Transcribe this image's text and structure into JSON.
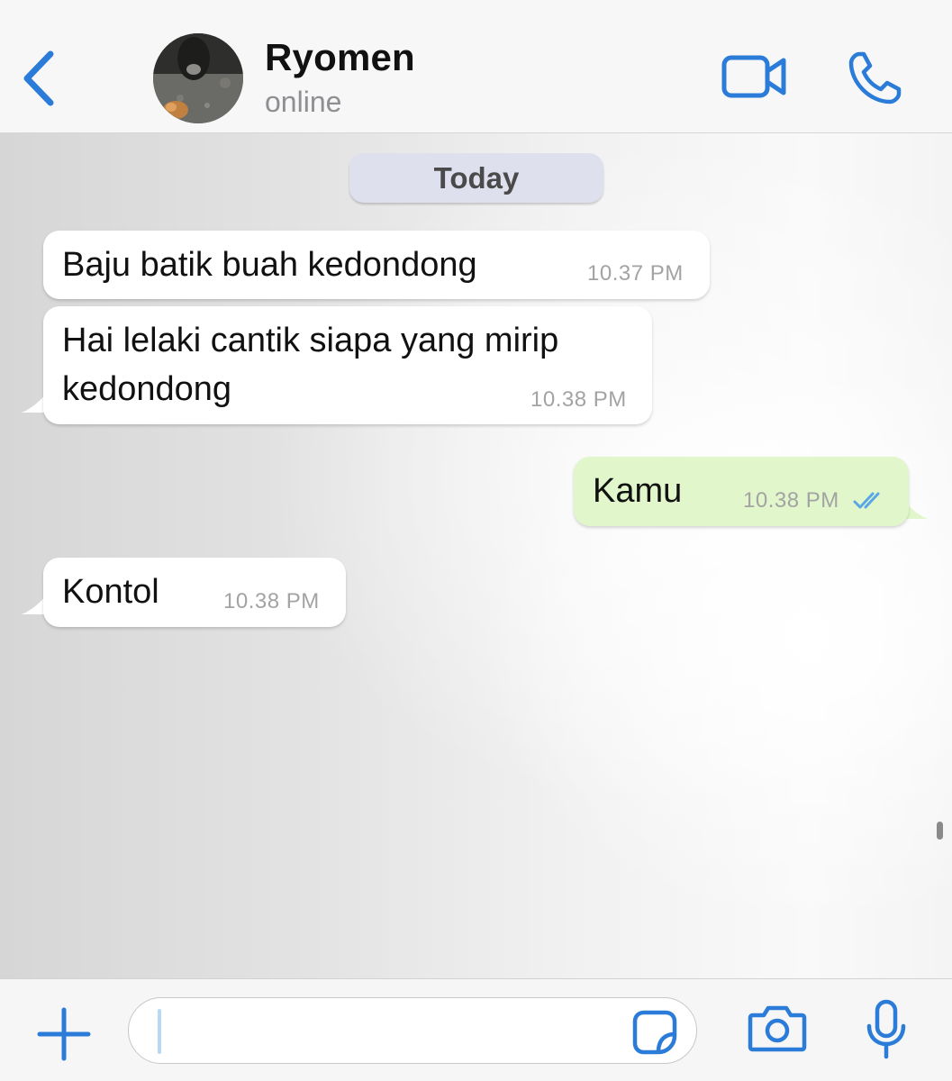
{
  "header": {
    "contact_name": "Ryomen",
    "status": "online",
    "back_icon": "chevron-left-icon",
    "video_icon": "video-camera-icon",
    "call_icon": "phone-icon"
  },
  "chat": {
    "date_label": "Today",
    "messages": [
      {
        "direction": "incoming",
        "text": "Baju batik buah kedondong",
        "time": "10.37 PM"
      },
      {
        "direction": "incoming",
        "lines": [
          "Hai lelaki cantik siapa yang mirip",
          "kedondong"
        ],
        "time": "10.38 PM"
      },
      {
        "direction": "outgoing",
        "text": "Kamu",
        "time": "10.38 PM",
        "status_icon": "double-check-read-icon"
      },
      {
        "direction": "incoming",
        "text": "Kontol",
        "time": "10.38 PM"
      }
    ]
  },
  "composer": {
    "input_value": "",
    "plus_icon": "plus-icon",
    "sticker_icon": "sticker-icon",
    "camera_icon": "camera-icon",
    "mic_icon": "microphone-icon"
  },
  "colors": {
    "accent": "#2b7cd9",
    "incoming_bubble": "#ffffff",
    "outgoing_bubble": "#e1f7cb",
    "read_ticks": "#5aa7e6",
    "date_pill": "#dfe0ee"
  }
}
